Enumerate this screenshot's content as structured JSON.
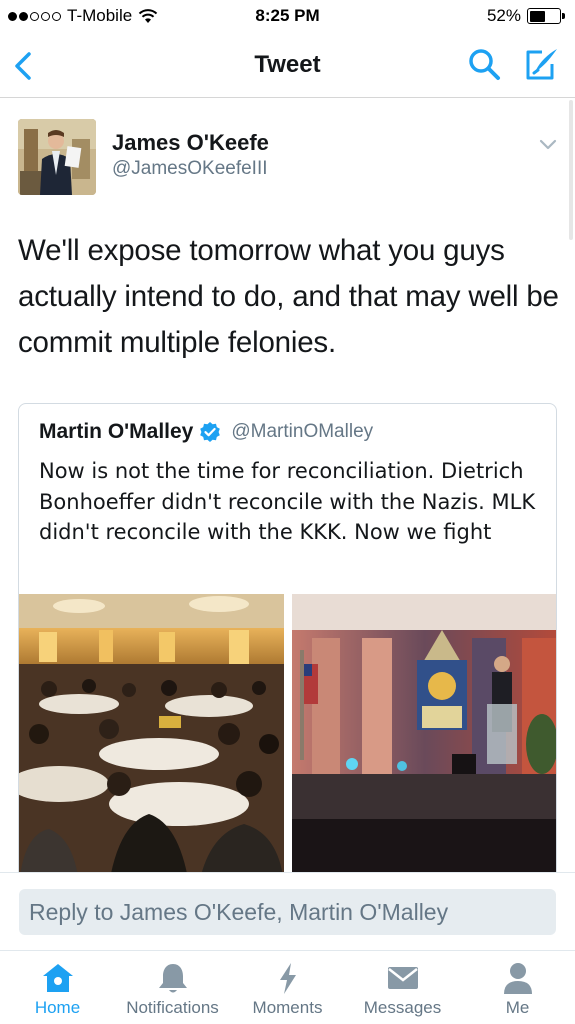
{
  "status_bar": {
    "carrier": "T-Mobile",
    "time": "8:25 PM",
    "battery_percent": "52%",
    "battery_level": 0.52,
    "signal_bars": 2
  },
  "nav": {
    "title": "Tweet",
    "back_icon": "chevron-left-icon",
    "search_icon": "search-icon",
    "compose_icon": "compose-icon"
  },
  "tweet": {
    "author_name": "James O'Keefe",
    "author_handle": "@JamesOKeefeIII",
    "text": "We'll expose tomorrow what you guys actually intend to do, and that may well be commit multiple felonies."
  },
  "quoted_tweet": {
    "author_name": "Martin O'Malley",
    "verified": true,
    "author_handle": "@MartinOMalley",
    "text": "Now is not the time for reconciliation. Dietrich Bonhoeffer didn't reconcile with the Nazis. MLK didn't reconcile with the KKK. Now we fight"
  },
  "reply": {
    "placeholder": "Reply to James O'Keefe, Martin O'Malley"
  },
  "tabs": [
    {
      "label": "Home",
      "icon": "home-icon",
      "active": true
    },
    {
      "label": "Notifications",
      "icon": "bell-icon",
      "active": false
    },
    {
      "label": "Moments",
      "icon": "lightning-icon",
      "active": false
    },
    {
      "label": "Messages",
      "icon": "envelope-icon",
      "active": false
    },
    {
      "label": "Me",
      "icon": "person-icon",
      "active": false
    }
  ],
  "colors": {
    "accent": "#1da1f2",
    "text": "#14171a",
    "secondary_text": "#657786"
  }
}
